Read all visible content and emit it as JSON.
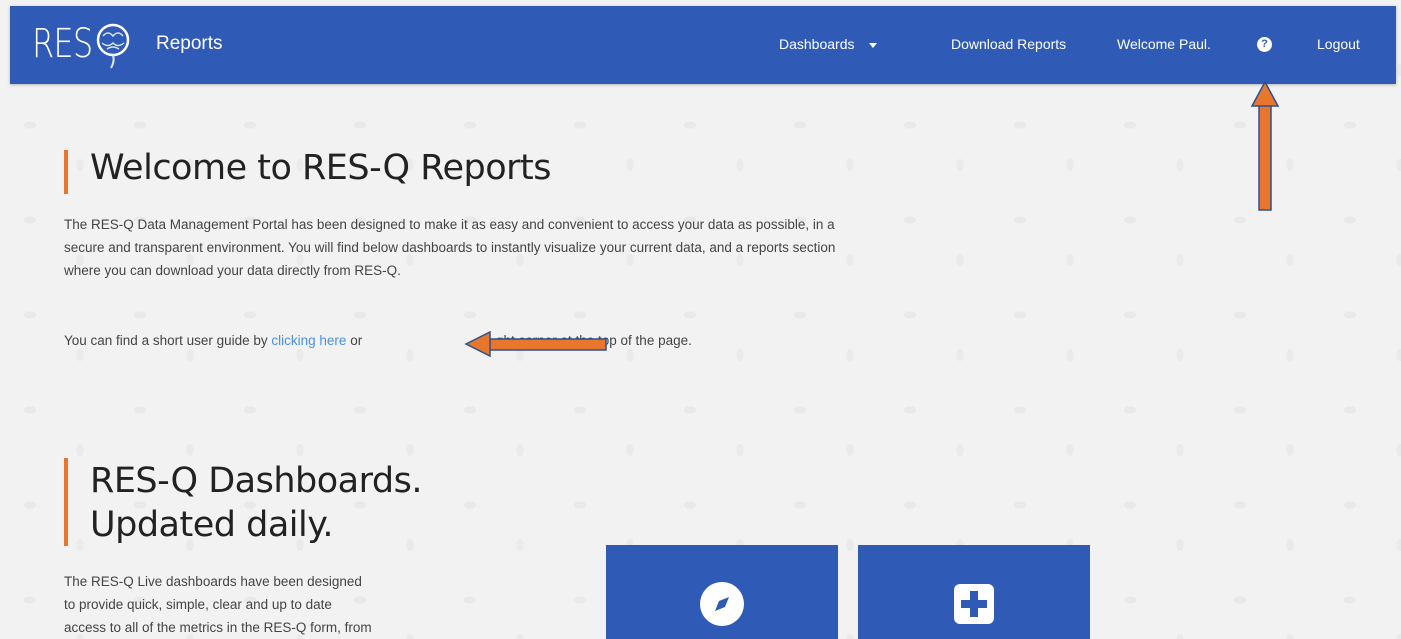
{
  "navbar": {
    "logo_text": "RES",
    "brand": "Reports",
    "items": [
      {
        "label": "Dashboards"
      },
      {
        "label": "Download Reports"
      },
      {
        "label": "Welcome Paul."
      },
      {
        "label": "Logout"
      }
    ],
    "help_glyph": "?"
  },
  "welcome": {
    "title": "Welcome to RES-Q Reports",
    "paragraph": "The RES-Q Data Management Portal has been designed to make it as easy and convenient to access your data as possible, in a secure and transparent environment. You will find below dashboards to instantly visualize your current data, and a reports section where you can download your data directly from RES-Q.",
    "guide_before": "You can find a short user guide by ",
    "guide_link": "clicking here",
    "guide_after": " or ",
    "guide_tail": "ght corner at the top of the page."
  },
  "dashboards": {
    "title_line1": "RES-Q Dashboards.",
    "title_line2": "Updated daily.",
    "paragraph_lines": [
      "The RES-Q Live dashboards have been designed",
      "to provide quick, simple, clear and up to date",
      "access to all of the metrics in the RES-Q form, from"
    ],
    "cards": [
      {
        "icon": "compass-icon"
      },
      {
        "icon": "plus-icon"
      }
    ]
  },
  "colors": {
    "brand_blue": "#2f5bb7",
    "accent_orange": "#e8762c",
    "link_blue": "#4a90e2"
  }
}
